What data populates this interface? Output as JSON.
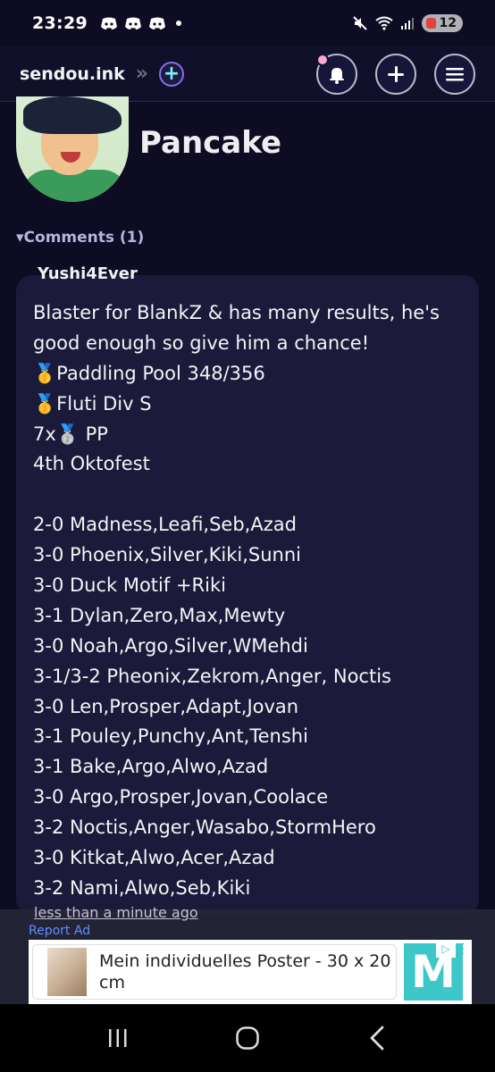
{
  "status_bar": {
    "time": "23:29",
    "notification_icons": [
      "discord-icon",
      "discord-icon",
      "discord-icon"
    ],
    "battery_level": "12"
  },
  "header": {
    "site_name": "sendou.ink",
    "breadcrumb_separator": "»",
    "plus_label": "+",
    "buttons": [
      "bell-icon",
      "plus-icon",
      "menu-icon"
    ]
  },
  "profile": {
    "name": "Pancake"
  },
  "comments": {
    "toggle_label": "▾Comments (1)",
    "items": [
      {
        "author": "Yushi4Ever",
        "lines": [
          "Blaster for BlankZ & has many results, he's",
          "good enough so give him a chance!",
          "🥇Paddling Pool 348/356",
          "🥇Fluti Div S",
          "7x🥈 PP",
          "4th Oktofest",
          "",
          "2-0 Madness,Leafi,Seb,Azad",
          "3-0 Phoenix,Silver,Kiki,Sunni",
          "3-0 Duck Motif +Riki",
          "3-1 Dylan,Zero,Max,Mewty",
          "3-0 Noah,Argo,Silver,WMehdi",
          "3-1/3-2 Pheonix,Zekrom,Anger, Noctis",
          "3-0 Len,Prosper,Adapt,Jovan",
          "3-1 Pouley,Punchy,Ant,Tenshi",
          "3-1 Bake,Argo,Alwo,Azad",
          "3-0 Argo,Prosper,Jovan,Coolace",
          "3-2 Noctis,Anger,Wasabo,StormHero",
          "3-0 Kitkat,Alwo,Acer,Azad",
          "3-2 Nami,Alwo,Seb,Kiki"
        ],
        "timestamp": "less than a minute ago"
      }
    ]
  },
  "ad": {
    "report_label": "Report Ad",
    "text": "Mein individuelles Poster - 30 x 20 cm",
    "logo_letter": "M"
  },
  "colors": {
    "background": "#0d0c22",
    "card": "#1b1a3b",
    "accent": "#8a6cf0",
    "link": "#5e90ff"
  }
}
